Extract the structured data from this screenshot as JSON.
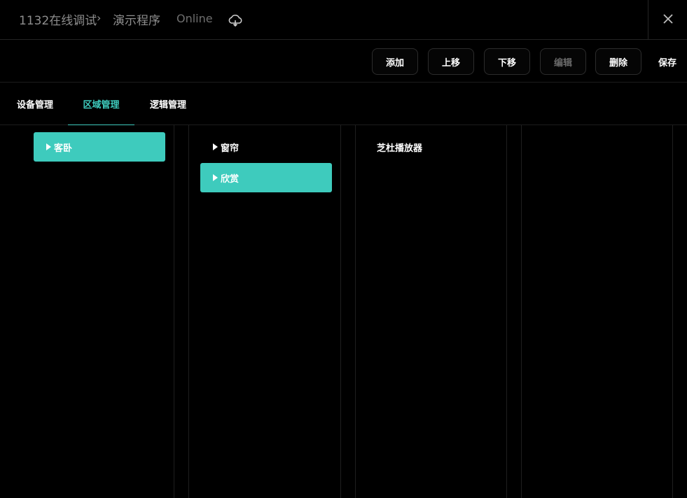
{
  "titlebar": {
    "root": "1132在线调试",
    "separator": "›",
    "current": "演示程序",
    "status": "Online",
    "cloud_icon": "cloud-sync-icon",
    "close_icon": "close-icon"
  },
  "toolbar": {
    "add": "添加",
    "move_up": "上移",
    "move_down": "下移",
    "edit": "编辑",
    "delete": "删除",
    "save": "保存"
  },
  "tabs": [
    {
      "label": "设备管理",
      "active": false
    },
    {
      "label": "区域管理",
      "active": true
    },
    {
      "label": "逻辑管理",
      "active": false
    }
  ],
  "columns": {
    "col1": [
      {
        "label": "客卧",
        "expandable": true,
        "selected": true
      }
    ],
    "col2": [
      {
        "label": "窗帘",
        "expandable": true,
        "selected": false
      },
      {
        "label": "欣赏",
        "expandable": true,
        "selected": true
      }
    ],
    "col3": [
      {
        "label": "芝杜播放器",
        "expandable": false,
        "selected": false
      }
    ],
    "col4": []
  },
  "colors": {
    "accent": "#3ecbbd",
    "background": "#000000",
    "border": "#1f1f1f",
    "muted_text": "#8e8e8e"
  }
}
